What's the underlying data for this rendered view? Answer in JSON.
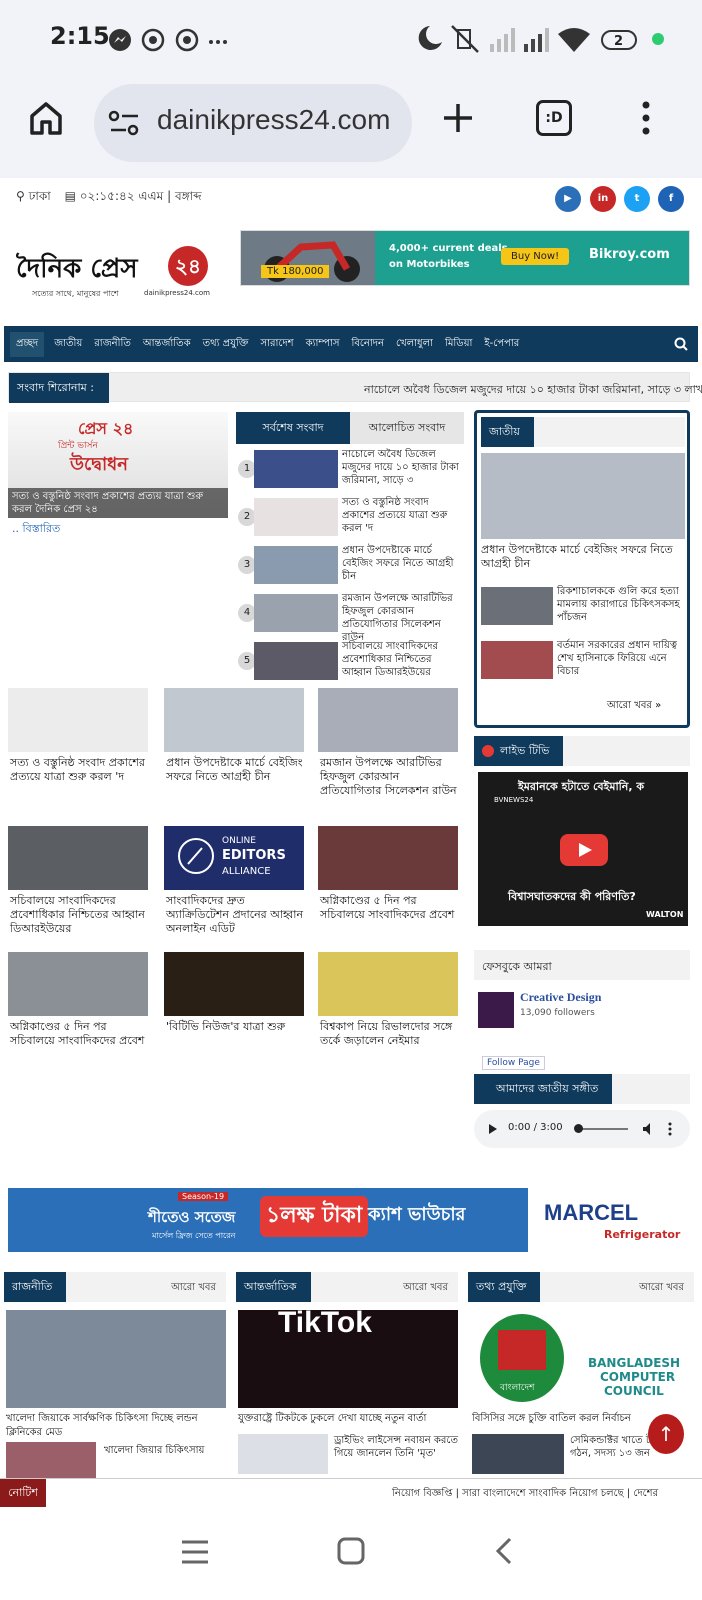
{
  "status_bar": {
    "time": "2:15",
    "battery": "2",
    "icons": [
      "messenger-icon",
      "whatsapp-icon",
      "whatsapp-icon",
      "more-dots-icon",
      "moon-icon",
      "mute-icon",
      "signal-icon",
      "signal-icon",
      "wifi-icon",
      "battery-icon",
      "dot-icon"
    ]
  },
  "browser": {
    "url": "dainikpress24.com",
    "tab_count": ":D"
  },
  "site": {
    "location": "ঢাকা",
    "datetime": "০২:১৫:৪২ এএম | বঙ্গাব্দ",
    "logo_text": "দৈনিক প্রেস",
    "logo_num": "২৪",
    "logo_tagline": "সত্যের সাথে, মানুষের পাশে",
    "logo_site": "dainikpress24.com",
    "social": [
      "youtube-icon",
      "linkedin-icon",
      "twitter-icon",
      "facebook-icon"
    ],
    "ad1": {
      "price": "Tk 180,000",
      "line1": "4,000+ current deals",
      "line2": "on Motorbikes",
      "btn": "Buy Now!",
      "brand": "Bikroy.com"
    }
  },
  "nav": [
    "প্রচ্ছদ",
    "জাতীয়",
    "রাজনীতি",
    "আন্তর্জাতিক",
    "তথ্য প্রযুক্তি",
    "সারাদেশ",
    "ক্যাম্পাস",
    "বিনোদন",
    "খেলাধুলা",
    "মিডিয়া",
    "ই-পেপার"
  ],
  "ticker": {
    "label": "সংবাদ শিরোনাম :",
    "text": "নাচোলে অবৈধ ডিজেল মজুদের দায়ে ১০ হাজার টাকা জরিমানা, সাড়ে ৩ লাখ"
  },
  "lead": {
    "img_title": "প্রেস ২৪",
    "img_sub": "প্রিন্ট ভার্সন",
    "img_big": "উদ্বোধন",
    "caption": "সত্য ও বস্তুনিষ্ঠ সংবাদ প্রকাশের প্রত্যয় যাত্রা শুরু করল দৈনিক প্রেস ২৪",
    "more": ".. বিস্তারিত"
  },
  "tabs": [
    "সর্বশেষ সংবাদ",
    "আলোচিত সংবাদ"
  ],
  "latest": [
    {
      "n": "1",
      "t": "নাচোলে অবৈধ ডিজেল মজুদের দায়ে ১০ হাজার টাকা জরিমানা, সাড়ে ৩"
    },
    {
      "n": "2",
      "t": "সত্য ও বস্তুনিষ্ঠ সংবাদ প্রকাশের প্রত্যয়ে যাত্রা শুরু করল 'দ"
    },
    {
      "n": "3",
      "t": "প্রধান উপদেষ্টাকে মার্চে বেইজিং সফরে নিতে আগ্রহী চীন"
    },
    {
      "n": "4",
      "t": "রমজান উপলক্ষে আরটিভির হিফজুল কোরআন প্রতিযোগিতার সিলেকশন রাউন"
    },
    {
      "n": "5",
      "t": "সচিবালয়ে সাংবাদিকদের প্রবেশাধিকার নিশ্চিতের আহ্বান ডিআরইউয়ের"
    }
  ],
  "national_box": {
    "head": "জাতীয়",
    "main": "প্রধান উপদেষ্টাকে মার্চে বেইজিং সফরে নিতে আগ্রহী চীন",
    "items": [
      "রিকশাচালককে গুলি করে হত্যা মামলায় কারাগারে চিকিৎসকসহ পাঁচজন",
      "বর্তমান সরকারের প্রধান দায়িত্ব শেখ হাসিনাকে ফিরিয়ে এনে বিচার"
    ],
    "more": "আরো খবর »"
  },
  "grid": [
    {
      "t": "সত্য ও বস্তুনিষ্ঠ সংবাদ প্রকাশের প্রত্যয়ে যাত্রা শুরু করল 'দ"
    },
    {
      "t": "প্রধান উপদেষ্টাকে মার্চে বেইজিং সফরে নিতে আগ্রহী চীন"
    },
    {
      "t": "রমজান উপলক্ষে আরটিভির হিফজুল কোরআন প্রতিযোগিতার সিলেকশন রাউন"
    },
    {
      "t": "সচিবালয়ে সাংবাদিকদের প্রবেশাধিকার নিশ্চিতের আহ্বান ডিআরইউয়ের"
    },
    {
      "t": "সাংবাদিকদের দ্রুত অ্যাক্রিডিটেশন প্রদানের আহ্বান অনলাইন এডিট"
    },
    {
      "t": "অগ্নিকাণ্ডের ৫ দিন পর সচিবালয়ে সাংবাদিকদের প্রবেশ"
    },
    {
      "t": "অগ্নিকাণ্ডের ৫ দিন পর সচিবালয়ে সাংবাদিকদের প্রবেশ"
    },
    {
      "t": "'বিটিভি নিউজ'র যাত্রা শুরু"
    },
    {
      "t": "বিশ্বকাপ নিয়ে রিভালদোর সঙ্গে তর্কে জড়ালেন নেইমার"
    }
  ],
  "oea": {
    "l1": "ONLINE",
    "l2": "EDITORS",
    "l3": "ALLIANCE"
  },
  "live": {
    "head": "লাইভ টিভি",
    "title": "ইমরানকে হটাতে বেইমানি, ক",
    "channel": "BVNEWS24",
    "caption": "বিশ্বাসঘাতকদের কী পরিণতি?",
    "brand": "WALTON"
  },
  "facebook": {
    "head": "ফেসবুকে আমরা",
    "page": "Creative Design",
    "followers": "13,090 followers",
    "follow": "Follow Page"
  },
  "anthem": {
    "head": "আমাদের জাতীয় সঙ্গীত",
    "time": "0:00 / 3:00"
  },
  "ad2": {
    "season": "Season-19",
    "l1": "শীতেও সতেজ",
    "l2": "মার্সেল ফ্রিজ সেতে পারেন",
    "big": "১লক্ষ টাকা",
    "cash": "ক্যাশ ভাউচার",
    "brand": "MARCEL",
    "sub": "Refrigerator"
  },
  "sections": [
    {
      "head": "রাজনীতি",
      "more": "আরো খবর",
      "main": "খালেদা জিয়াকে সার্বক্ষণিক চিকিৎসা দিচ্ছে লন্ডন ক্লিনিকের মেড",
      "sub": "খালেদা জিয়ার চিকিৎসায়"
    },
    {
      "head": "আন্তর্জাতিক",
      "more": "আরো খবর",
      "main": "যুক্তরাষ্ট্রে টিকটকে ঢুকলে দেখা যাচ্ছে নতুন বার্তা",
      "sub": "ড্রাইভিং লাইসেন্স নবায়ন করতে গিয়ে জানলেন তিনি 'মৃত'"
    },
    {
      "head": "তথ্য প্রযুক্তি",
      "more": "আরো খবর",
      "main": "বিসিসির সঙ্গে চুক্তি বাতিল করল নির্বাচন",
      "sub": "সেমিকন্ডাক্টর খাতে টাস্কফোর্স গঠন, সদস্য ১৩ জন"
    }
  ],
  "tiktok": "TikTok",
  "bcc": {
    "l1": "BANGLADESH",
    "l2": "COMPUTER",
    "l3": "COUNCIL",
    "ec": "বাংলাদেশ"
  },
  "notice": {
    "label": "নোটিশ",
    "text": "নিয়োগ বিজ্ঞপ্তি | সারা বাংলাদেশে সাংবাদিক নিয়োগ চলছে | দেশের"
  }
}
